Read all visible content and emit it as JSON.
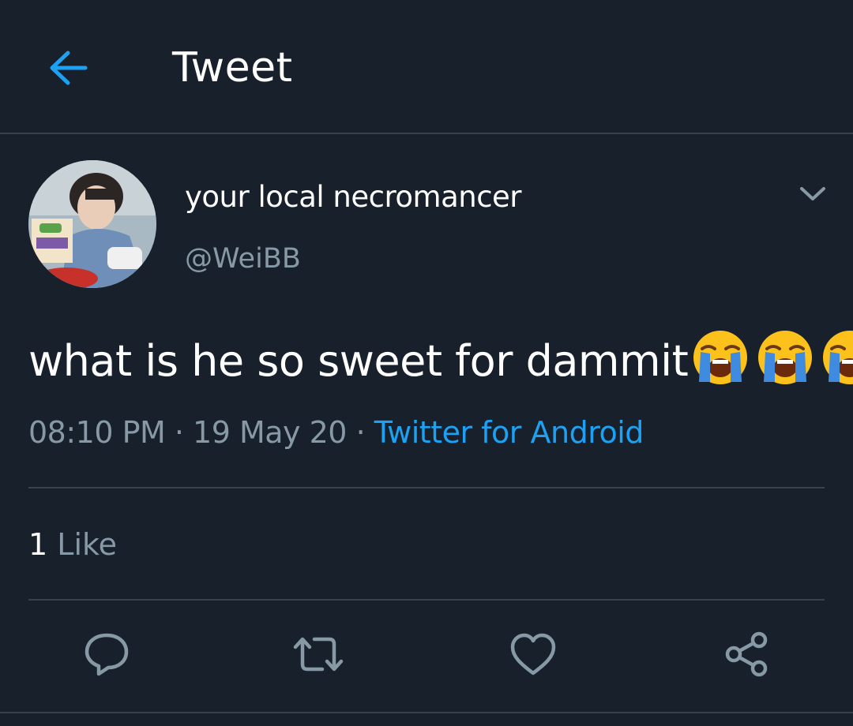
{
  "header": {
    "title": "Tweet"
  },
  "author": {
    "display_name": "your local necromancer",
    "handle": "@WeiBB"
  },
  "tweet": {
    "text": "what is he so sweet for dammit",
    "emojis": [
      "loudly-crying-face",
      "loudly-crying-face",
      "loudly-crying-face"
    ],
    "time": "08:10 PM",
    "separator": " · ",
    "date": "19 May 20",
    "source": "Twitter for Android"
  },
  "stats": {
    "like_count": "1",
    "like_label": "Like"
  },
  "icons": {
    "back": "arrow-left-icon",
    "caret": "chevron-down-icon",
    "reply": "speech-bubble-icon",
    "retweet": "retweet-icon",
    "like": "heart-icon",
    "share": "share-icon"
  },
  "colors": {
    "background": "#17202b",
    "accent": "#1da1f2",
    "muted_text": "#8899a6",
    "divider": "#38444d",
    "icon": "#8899a6"
  }
}
